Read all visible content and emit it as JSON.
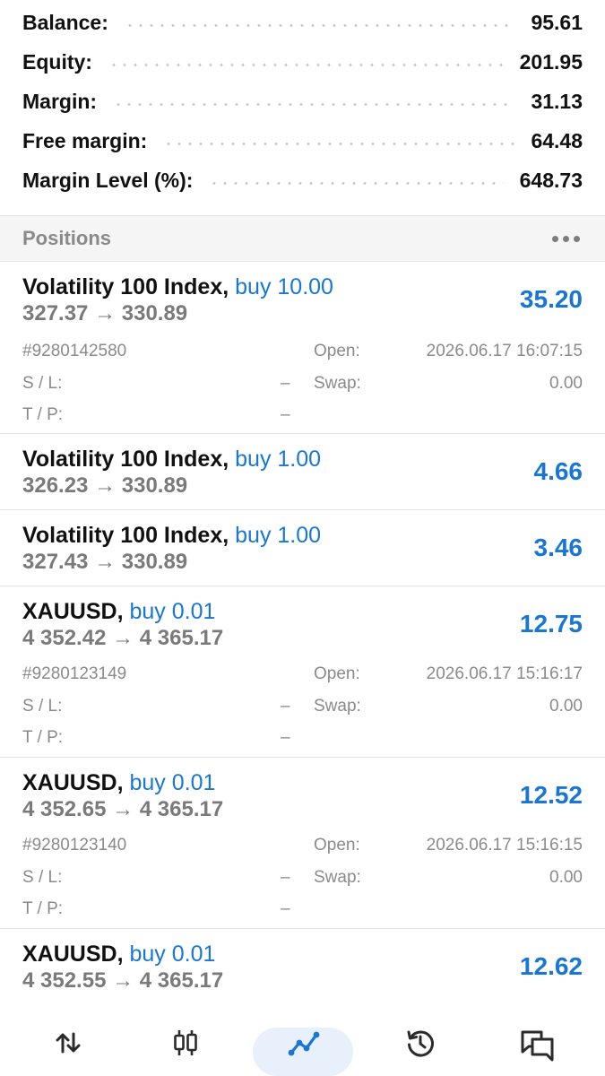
{
  "summary": {
    "balance": {
      "label": "Balance:",
      "value": "95.61"
    },
    "equity": {
      "label": "Equity:",
      "value": "201.95"
    },
    "margin": {
      "label": "Margin:",
      "value": "31.13"
    },
    "free_margin": {
      "label": "Free margin:",
      "value": "64.48"
    },
    "margin_level": {
      "label": "Margin Level (%):",
      "value": "648.73"
    }
  },
  "positions_header": {
    "title": "Positions",
    "menu_icon": "more-horizontal-icon"
  },
  "labels": {
    "open": "Open:",
    "sl": "S / L:",
    "tp": "T / P:",
    "swap": "Swap:"
  },
  "positions": [
    {
      "symbol": "Volatility 100 Index,",
      "direction": "buy 10.00",
      "prices": "327.37 → 330.89",
      "profit": "35.20",
      "expanded": true,
      "ticket": "#9280142580",
      "open_time": "2026.06.17 16:07:15",
      "sl": "–",
      "tp": "–",
      "swap": "0.00"
    },
    {
      "symbol": "Volatility 100 Index,",
      "direction": "buy 1.00",
      "prices": "326.23 → 330.89",
      "profit": "4.66",
      "expanded": false
    },
    {
      "symbol": "Volatility 100 Index,",
      "direction": "buy 1.00",
      "prices": "327.43 → 330.89",
      "profit": "3.46",
      "expanded": false
    },
    {
      "symbol": "XAUUSD,",
      "direction": "buy 0.01",
      "prices": "4 352.42 → 4 365.17",
      "profit": "12.75",
      "expanded": true,
      "ticket": "#9280123149",
      "open_time": "2026.06.17 15:16:17",
      "sl": "–",
      "tp": "–",
      "swap": "0.00"
    },
    {
      "symbol": "XAUUSD,",
      "direction": "buy 0.01",
      "prices": "4 352.65 → 4 365.17",
      "profit": "12.52",
      "expanded": true,
      "ticket": "#9280123140",
      "open_time": "2026.06.17 15:16:15",
      "sl": "–",
      "tp": "–",
      "swap": "0.00"
    },
    {
      "symbol": "XAUUSD,",
      "direction": "buy 0.01",
      "prices": "4 352.55 → 4 365.17",
      "profit": "12.62",
      "expanded": false
    }
  ],
  "nav": {
    "items": [
      {
        "icon": "quotes-arrows-icon"
      },
      {
        "icon": "candlestick-chart-icon"
      },
      {
        "icon": "trade-line-icon",
        "active": true
      },
      {
        "icon": "history-clock-icon"
      },
      {
        "icon": "chat-messages-icon"
      }
    ],
    "accent": "#1976d2"
  },
  "colors": {
    "accent": "#1976d2",
    "muted": "#8a8a8a",
    "header_bg": "#f5f5f5",
    "active_pill": "#e8f1fb"
  }
}
